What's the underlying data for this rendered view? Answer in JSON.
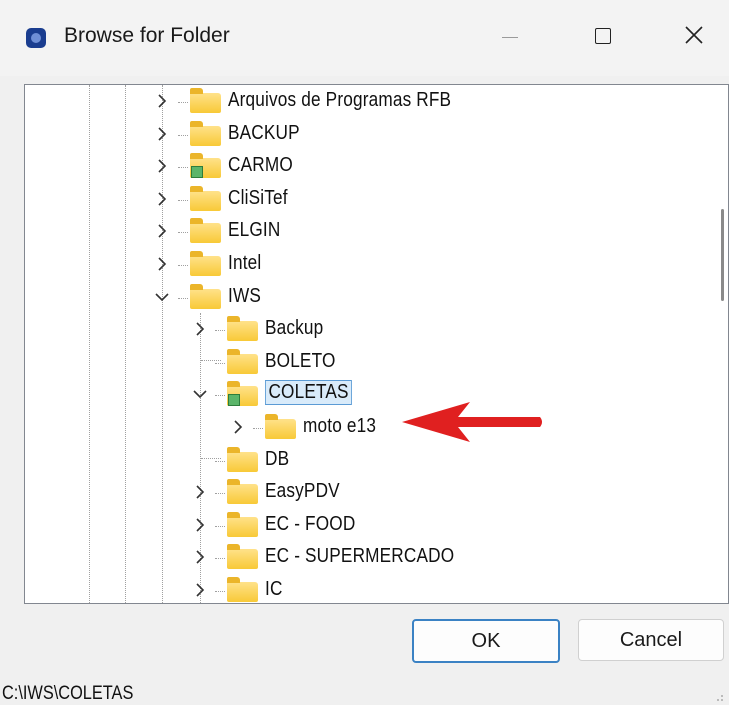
{
  "window": {
    "title": "Browse for Folder",
    "controls": [
      "minimize-icon",
      "maximize-icon",
      "close-icon"
    ]
  },
  "tree": {
    "items": [
      {
        "label": "Arquivos de Programas RFB",
        "level": 1,
        "state": "collapsed"
      },
      {
        "label": "BACKUP",
        "level": 1,
        "state": "collapsed"
      },
      {
        "label": "CARMO",
        "level": 1,
        "state": "collapsed",
        "shared": true
      },
      {
        "label": "CliSiTef",
        "level": 1,
        "state": "collapsed"
      },
      {
        "label": "ELGIN",
        "level": 1,
        "state": "collapsed"
      },
      {
        "label": "Intel",
        "level": 1,
        "state": "collapsed"
      },
      {
        "label": "IWS",
        "level": 1,
        "state": "expanded"
      },
      {
        "label": "Backup",
        "level": 2,
        "state": "collapsed"
      },
      {
        "label": "BOLETO",
        "level": 2,
        "state": "leaf"
      },
      {
        "label": "COLETAS",
        "level": 2,
        "state": "expanded",
        "selected": true,
        "shared": true
      },
      {
        "label": "moto e13",
        "level": 3,
        "state": "collapsed"
      },
      {
        "label": "DB",
        "level": 2,
        "state": "leaf"
      },
      {
        "label": "EasyPDV",
        "level": 2,
        "state": "collapsed"
      },
      {
        "label": "EC - FOOD",
        "level": 2,
        "state": "collapsed"
      },
      {
        "label": "EC - SUPERMERCADO",
        "level": 2,
        "state": "collapsed"
      },
      {
        "label": "IC",
        "level": 2,
        "state": "collapsed"
      }
    ]
  },
  "annotation": {
    "arrow_color": "#e02020"
  },
  "buttons": {
    "ok_label": "OK",
    "cancel_label": "Cancel"
  },
  "status": {
    "path": "C:\\IWS\\COLETAS"
  }
}
